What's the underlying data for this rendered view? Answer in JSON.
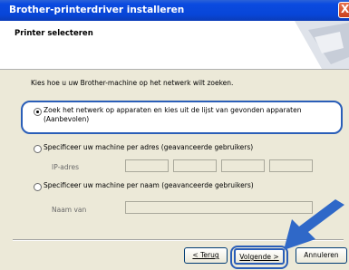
{
  "window": {
    "title": "Brother-printerdriver installeren",
    "close_glyph": "X"
  },
  "header": {
    "title": "Printer selecteren"
  },
  "content": {
    "instruction": "Kies hoe u uw Brother-machine op het netwerk wilt zoeken.",
    "option1_line1": "Zoek het netwerk op apparaten en kies uit de lijst van gevonden apparaten",
    "option1_line2": "(Aanbevolen)",
    "option2": "Specificeer uw machine per adres (geavanceerde gebruikers)",
    "ip_label": "IP-adres",
    "option3": "Specificeer uw machine per naam (geavanceerde gebruikers)",
    "name_label": "Naam van"
  },
  "buttons": {
    "back": "< Terug",
    "next": "Volgende >",
    "cancel": "Annuleren"
  },
  "colors": {
    "titlebar": "#0846d8",
    "highlight": "#2a5eb8",
    "arrow": "#2f68c8"
  }
}
